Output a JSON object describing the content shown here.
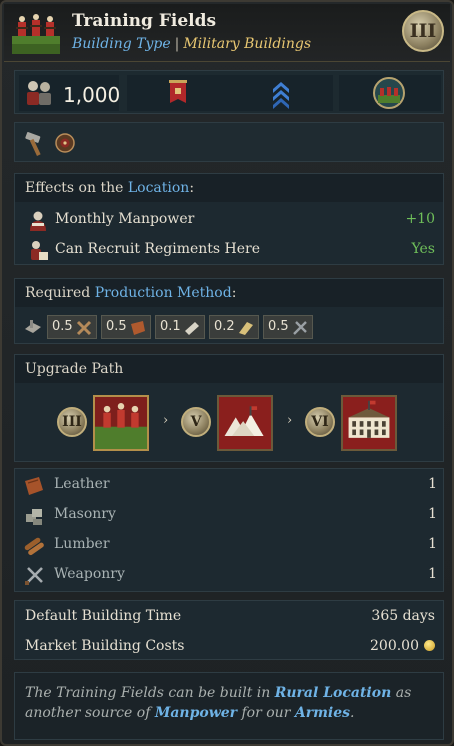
{
  "header": {
    "title": "Training Fields",
    "type_label": "Building Type",
    "separator": "|",
    "category": "Military Buildings",
    "tier": "III"
  },
  "stats": {
    "population": "1,000",
    "icons": [
      "population-icon",
      "banner-icon",
      "chevron-rank-icon",
      "training-fields-badge-icon"
    ]
  },
  "tools": {
    "icons": [
      "hammer-icon",
      "target-icon"
    ]
  },
  "effects": {
    "heading_prefix": "Effects on the",
    "heading_link": "Location",
    "heading_suffix": ":",
    "items": [
      {
        "label": "Monthly Manpower",
        "value": "+10",
        "icon": "manpower-icon"
      },
      {
        "label": "Can Recruit Regiments Here",
        "value": "Yes",
        "icon": "recruit-icon"
      }
    ]
  },
  "production": {
    "heading_prefix": "Required",
    "heading_link": "Production Method",
    "heading_suffix": ":",
    "inputs": [
      {
        "amount": "0.5",
        "icon": "tools-icon"
      },
      {
        "amount": "0.5",
        "icon": "leather-icon"
      },
      {
        "amount": "0.1",
        "icon": "paper-icon"
      },
      {
        "amount": "0.2",
        "icon": "cloth-icon"
      },
      {
        "amount": "0.5",
        "icon": "weaponry-icon"
      }
    ]
  },
  "upgrade": {
    "heading": "Upgrade Path",
    "steps": [
      {
        "tier": "III",
        "building": "training-fields-icon"
      },
      {
        "tier": "V",
        "building": "tent-camp-icon"
      },
      {
        "tier": "VI",
        "building": "barracks-icon"
      }
    ],
    "arrow": "›"
  },
  "costs": [
    {
      "label": "Leather",
      "value": "1",
      "icon": "leather-icon"
    },
    {
      "label": "Masonry",
      "value": "1",
      "icon": "masonry-icon"
    },
    {
      "label": "Lumber",
      "value": "1",
      "icon": "lumber-icon"
    },
    {
      "label": "Weaponry",
      "value": "1",
      "icon": "weaponry-icon"
    }
  ],
  "time": {
    "build_time_label": "Default Building Time",
    "build_time_value": "365 days",
    "market_cost_label": "Market Building Costs",
    "market_cost_value": "200.00"
  },
  "description": {
    "part1": "The Training Fields can be built in",
    "link1": "Rural Location",
    "part2": "as another source of",
    "link2": "Manpower",
    "part3": "for our",
    "link3": "Armies",
    "part4": "."
  },
  "colors": {
    "accent_blue": "#6fb3e6",
    "positive_green": "#6fbf5a",
    "gold": "#e8c772"
  }
}
